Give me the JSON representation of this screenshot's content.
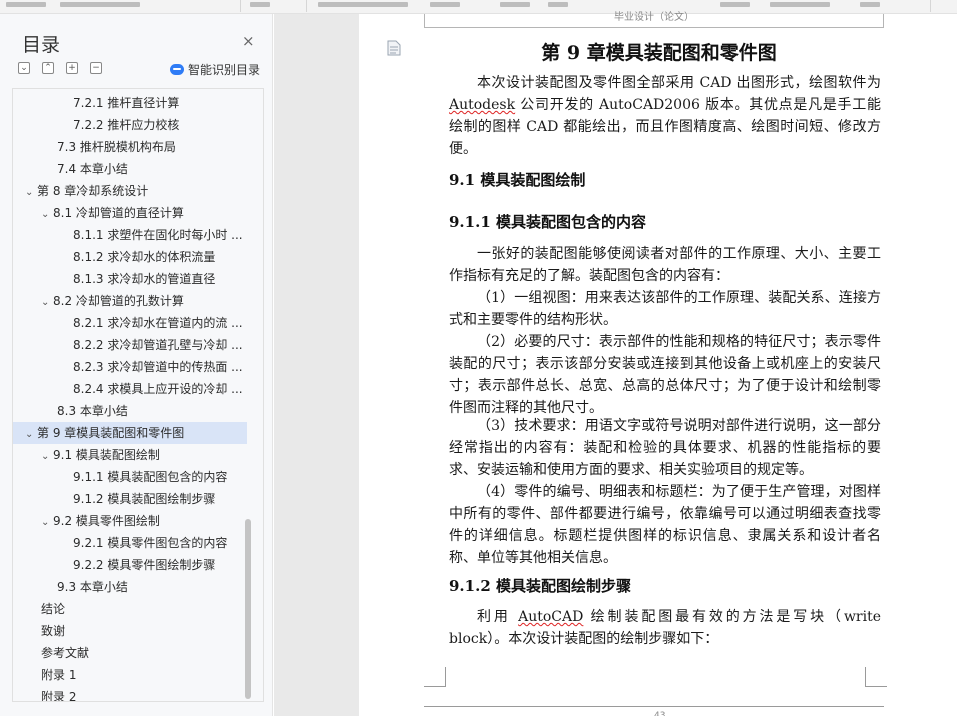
{
  "toolbar": {
    "visible": "partial"
  },
  "toc": {
    "title": "目录",
    "close_label": "×",
    "tools": [
      "⌄",
      "⌃",
      "+",
      "−"
    ],
    "smart_label": "智能识别目录",
    "items": [
      {
        "label": "7.2.1 推杆直径计算",
        "level": 3,
        "chev": ""
      },
      {
        "label": "7.2.2 推杆应力校核",
        "level": 3,
        "chev": ""
      },
      {
        "label": "7.3 推杆脱模机构布局",
        "level": 2,
        "chev": ""
      },
      {
        "label": "7.4 本章小结",
        "level": 2,
        "chev": ""
      },
      {
        "label": "第 8 章冷却系统设计",
        "level": 1,
        "chev": "⌄"
      },
      {
        "label": "8.1 冷却管道的直径计算",
        "level": 2,
        "chev": "⌄"
      },
      {
        "label": "8.1.1 求塑件在固化时每小时 ...",
        "level": 3,
        "chev": ""
      },
      {
        "label": "8.1.2 求冷却水的体积流量",
        "level": 3,
        "chev": ""
      },
      {
        "label": "8.1.3 求冷却水的管道直径",
        "level": 3,
        "chev": ""
      },
      {
        "label": "8.2 冷却管道的孔数计算",
        "level": 2,
        "chev": "⌄"
      },
      {
        "label": "8.2.1 求冷却水在管道内的流 ...",
        "level": 3,
        "chev": ""
      },
      {
        "label": "8.2.2 求冷却管道孔壁与冷却 ...",
        "level": 3,
        "chev": ""
      },
      {
        "label": "8.2.3 求冷却管道中的传热面 ...",
        "level": 3,
        "chev": ""
      },
      {
        "label": "8.2.4 求模具上应开设的冷却 ...",
        "level": 3,
        "chev": ""
      },
      {
        "label": "8.3 本章小结",
        "level": 2,
        "chev": ""
      },
      {
        "label": "第 9 章模具装配图和零件图",
        "level": 1,
        "chev": "⌄",
        "active": true
      },
      {
        "label": "9.1 模具装配图绘制",
        "level": 2,
        "chev": "⌄"
      },
      {
        "label": "9.1.1 模具装配图包含的内容",
        "level": 3,
        "chev": ""
      },
      {
        "label": "9.1.2 模具装配图绘制步骤",
        "level": 3,
        "chev": ""
      },
      {
        "label": "9.2 模具零件图绘制",
        "level": 2,
        "chev": "⌄"
      },
      {
        "label": "9.2.1 模具零件图包含的内容",
        "level": 3,
        "chev": ""
      },
      {
        "label": "9.2.2 模具零件图绘制步骤",
        "level": 3,
        "chev": ""
      },
      {
        "label": "9.3 本章小结",
        "level": 2,
        "chev": ""
      },
      {
        "label": "结论",
        "level": 1,
        "chev": ""
      },
      {
        "label": "致谢",
        "level": 1,
        "chev": ""
      },
      {
        "label": "参考文献",
        "level": 1,
        "chev": ""
      },
      {
        "label": "附录 1",
        "level": 1,
        "chev": ""
      },
      {
        "label": "附录 2",
        "level": 1,
        "chev": ""
      }
    ]
  },
  "doc": {
    "header_text": "毕业设计（论文）",
    "chapter_title": "第 9 章模具装配图和零件图",
    "intro_pre": "本次设计装配图及零件图全部采用 CAD 出图形式，绘图软件为 ",
    "intro_brand": "Autodesk",
    "intro_post": " 公司开发的 AutoCAD2006 版本。其优点是凡是手工能绘制的图样 CAD 都能绘出，而且作图精度高、绘图时间短、修改方便。",
    "h_9_1": "9.1  模具装配图绘制",
    "h_9_1_1": "9.1.1  模具装配图包含的内容",
    "p_1": "一张好的装配图能够使阅读者对部件的工作原理、大小、主要工作指标有充足的了解。装配图包含的内容有：",
    "p_2": "（1）一组视图：用来表达该部件的工作原理、装配关系、连接方式和主要零件的结构形状。",
    "p_3": "（2）必要的尺寸：表示部件的性能和规格的特征尺寸；表示零件装配的尺寸；表示该部分安装或连接到其他设备上或机座上的安装尺寸；表示部件总长、总宽、总高的总体尺寸；为了便于设计和绘制零件图而注释的其他尺寸。",
    "p_4": "（3）技术要求：用语文字或符号说明对部件进行说明，这一部分经常指出的内容有：装配和检验的具体要求、机器的性能指标的要求、安装运输和使用方面的要求、相关实验项目的规定等。",
    "p_5": "（4）零件的编号、明细表和标题栏：为了便于生产管理，对图样中所有的零件、部件都要进行编号，依靠编号可以通过明细表查找零件的详细信息。标题栏提供图样的标识信息、隶属关系和设计者名称、单位等其他相关信息。",
    "h_9_1_2": "9.1.2  模具装配图绘制步骤",
    "p_6_pre": "利用 ",
    "p_6_brand": "AutoCAD",
    "p_6_post": " 绘制装配图最有效的方法是写块（write block）。本次设计装配图的绘制步骤如下：",
    "page_num": "43"
  }
}
